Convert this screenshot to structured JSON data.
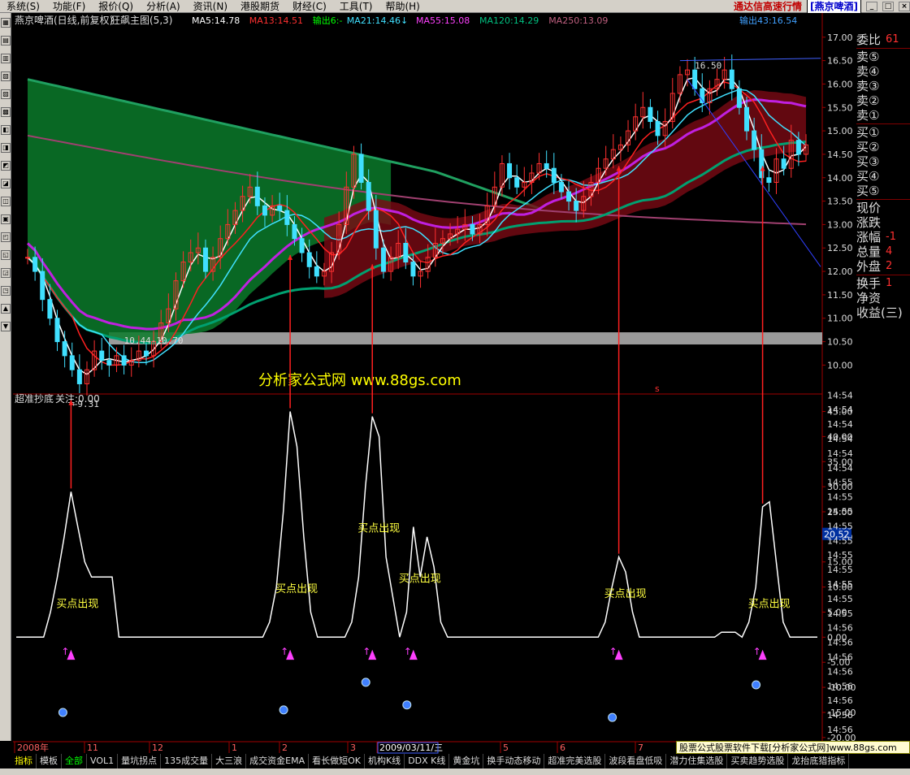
{
  "menubar": {
    "items": [
      "系统(S)",
      "功能(F)",
      "报价(Q)",
      "分析(A)",
      "资讯(N)",
      "港股期货",
      "财经(C)",
      "工具(T)",
      "帮助(H)"
    ],
    "banner": "通达信高速行情",
    "stock_name": "[燕京啤酒]"
  },
  "main_header": {
    "title": "燕京啤酒(日线,前复权)",
    "indicator": "狂飙主图(5,3)",
    "ma_labels": [
      {
        "text": "MA5:14.78",
        "color": "#ffffff"
      },
      {
        "text": "MA13:14.51",
        "color": "#ff3030"
      },
      {
        "text": "输出6:-",
        "color": "#00ff00"
      },
      {
        "text": "MA21:14.46↓",
        "color": "#40e0ff"
      },
      {
        "text": "MA55:15.08",
        "color": "#ff40ff"
      },
      {
        "text": "MA120:14.29",
        "color": "#00c080"
      },
      {
        "text": "MA250:13.09",
        "color": "#c06080"
      }
    ],
    "right_label": "输出43:16.54"
  },
  "watermark": "分析家公式网 www.88gs.com",
  "sub_header": {
    "title": "超准抄底",
    "value": "关注:0.00"
  },
  "right_panel": {
    "rows": [
      {
        "label": "委比",
        "value": "61"
      },
      {
        "label": "卖⑤",
        "value": ""
      },
      {
        "label": "卖④",
        "value": ""
      },
      {
        "label": "卖③",
        "value": ""
      },
      {
        "label": "卖②",
        "value": ""
      },
      {
        "label": "卖①",
        "value": ""
      },
      {
        "label": "买①",
        "value": ""
      },
      {
        "label": "买②",
        "value": ""
      },
      {
        "label": "买③",
        "value": ""
      },
      {
        "label": "买④",
        "value": ""
      },
      {
        "label": "买⑤",
        "value": ""
      },
      {
        "label": "现价",
        "value": ""
      },
      {
        "label": "涨跌",
        "value": ""
      },
      {
        "label": "涨幅",
        "value": "-1"
      },
      {
        "label": "总量",
        "value": "4"
      },
      {
        "label": "外盘",
        "value": "2"
      },
      {
        "label": "换手",
        "value": "1"
      },
      {
        "label": "净资",
        "value": ""
      },
      {
        "label": "收益(三)",
        "value": ""
      }
    ]
  },
  "time_column": [
    "14:54",
    "14:54",
    "14:54",
    "14:54",
    "14:54",
    "14:54",
    "14:55",
    "14:55",
    "14:55",
    "14:55",
    "14:55",
    "14:55",
    "14:55",
    "14:55",
    "14:55",
    "14:55",
    "14:56",
    "14:56",
    "14:56",
    "14:56",
    "14:56",
    "14:56",
    "14:56",
    "14:56",
    "14:56",
    "14:56",
    "14:56"
  ],
  "date_axis": {
    "labels": [
      "2008年",
      "11",
      "12",
      "1",
      "2",
      "3",
      "2009/03/11/三",
      "5",
      "6",
      "7"
    ]
  },
  "tabs": {
    "items": [
      "指标",
      "模板",
      "全部",
      "VOL1",
      "量坑拐点",
      "135成交量",
      "大三浪",
      "成交资金EMA",
      "看长做短OK",
      "机构K线",
      "DDX K线",
      "黄金坑",
      "换手动态移动",
      "超准完美选股",
      "波段看盘低吸",
      "潜力住集选股",
      "买卖趋势选股",
      "龙抬底猎指标"
    ],
    "active": "指标",
    "special": "全部"
  },
  "ad_text": "股票公式股票软件下载[分析家公式网]www.88gs.com",
  "chart_data": [
    {
      "type": "candlestick",
      "title": "燕京啤酒(日线,前复权)",
      "ylim": [
        9.4,
        17.1
      ],
      "yticks": [
        17.0,
        16.5,
        16.0,
        15.5,
        15.0,
        14.5,
        14.0,
        13.5,
        13.0,
        12.5,
        12.0,
        11.5,
        11.0,
        10.5,
        10.0
      ],
      "annotations": [
        {
          "text": "16.50",
          "price": 16.5
        },
        {
          "text": "9.31",
          "price": 9.31
        },
        {
          "text": "10.44-10.70",
          "price": 10.7
        }
      ],
      "close": [
        12.3,
        12.0,
        11.4,
        11.0,
        10.5,
        10.2,
        9.9,
        9.6,
        9.9,
        10.3,
        10.1,
        10.0,
        10.2,
        10.0,
        10.1,
        10.3,
        10.2,
        10.5,
        10.9,
        11.2,
        11.8,
        12.2,
        12.4,
        12.5,
        12.0,
        12.3,
        12.7,
        13.0,
        13.3,
        13.6,
        13.8,
        13.4,
        13.2,
        13.4,
        13.3,
        13.0,
        12.7,
        12.4,
        12.1,
        11.9,
        12.0,
        12.4,
        13.0,
        13.8,
        14.5,
        13.9,
        13.3,
        12.5,
        12.0,
        12.3,
        12.6,
        12.2,
        11.9,
        12.0,
        12.3,
        12.6,
        12.7,
        12.8,
        12.9,
        13.0,
        12.8,
        13.0,
        13.4,
        13.8,
        14.3,
        14.0,
        13.8,
        13.9,
        14.1,
        14.3,
        14.2,
        13.9,
        13.7,
        13.5,
        13.3,
        13.6,
        13.9,
        14.2,
        14.4,
        14.6,
        14.7,
        15.0,
        15.3,
        15.5,
        15.2,
        14.9,
        15.2,
        15.8,
        16.2,
        16.3,
        15.9,
        15.6,
        15.9,
        16.1,
        16.3,
        15.9,
        15.5,
        15.0,
        14.6,
        14.0,
        13.9,
        14.4,
        14.2,
        14.8,
        14.5,
        14.7
      ]
    },
    {
      "type": "line",
      "title": "超准抄底",
      "ylim": [
        -21,
        48
      ],
      "yticks": [
        45.0,
        40.0,
        35.0,
        30.0,
        25.0,
        20.0,
        15.0,
        10.0,
        5.0,
        0.0,
        -5.0,
        -10.0,
        -15.0,
        -20.0
      ],
      "current_value": "20.52",
      "labels": [
        "买点出现",
        "买点出现",
        "买点出现",
        "买点出现",
        "买点出现",
        "买点出现"
      ],
      "series": [
        {
          "values": [
            0,
            0,
            0,
            0,
            0,
            5,
            12,
            20,
            29,
            22,
            15,
            12,
            12,
            12,
            12,
            0,
            0,
            0,
            0,
            0,
            0,
            0,
            0,
            0,
            0,
            0,
            0,
            0,
            0,
            0,
            0,
            0,
            0,
            0,
            0,
            0,
            0,
            3,
            10,
            25,
            45,
            38,
            20,
            5,
            0,
            0,
            0,
            0,
            0,
            3,
            12,
            30,
            44,
            40,
            16,
            8,
            0,
            5,
            22,
            12,
            20,
            14,
            3,
            0,
            0,
            0,
            0,
            0,
            0,
            0,
            0,
            0,
            0,
            0,
            0,
            0,
            0,
            0,
            0,
            0,
            0,
            0,
            0,
            0,
            0,
            0,
            3,
            10,
            16,
            13,
            5,
            0,
            0,
            0,
            0,
            0,
            0,
            0,
            0,
            0,
            0,
            0,
            0,
            1,
            1,
            1,
            0,
            3,
            10,
            26,
            27,
            15,
            3,
            0,
            0,
            0,
            0,
            0
          ]
        }
      ]
    }
  ]
}
